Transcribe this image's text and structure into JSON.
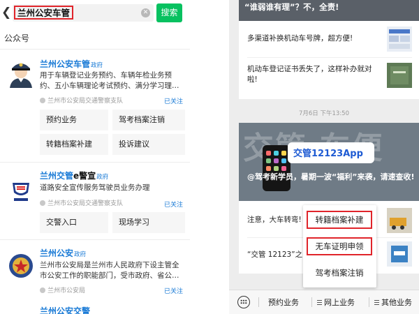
{
  "search": {
    "query": "兰州公安车管",
    "button_label": "搜索"
  },
  "section_title": "公众号",
  "accounts": [
    {
      "name": "兰州公安车管",
      "badge": "政府",
      "description": "用于车辆登记业务预约、车辆年检业务预约、五小车辆理论考试预约、满分学习理…",
      "meta": "兰州市公安局交通警察支队",
      "follow_status": "已关注",
      "menu": [
        "预约业务",
        "驾考档案注销",
        "转籍档案补建",
        "投诉建议"
      ]
    },
    {
      "name_prefix": "兰州交管",
      "name_suffix": "e警宣",
      "badge": "政府",
      "description": "道路安全宣传服务驾驶员业务办理",
      "meta": "兰州市公安局交通警察支队",
      "follow_status": "已关注",
      "menu": [
        "交警入口",
        "现场学习"
      ]
    },
    {
      "name": "兰州公安",
      "badge": "政府",
      "description": "兰州市公安局是兰州市人民政府下设主管全市公安工作的职能部门，受市政府、省公…",
      "meta": "兰州市公安局",
      "follow_status": "已关注",
      "next_name_partial": "兰州公安交警"
    }
  ],
  "chat": {
    "banner_text": "“谁弱谁有理”？不，全责!",
    "articles_top": [
      "多渠道补换机动车号牌，超方便!",
      "机动车登记证书丢失了，这样补办就对啦!"
    ],
    "timestamp": "7月6日 下午13:50",
    "hero_bg_text": "交管 车便",
    "hero_pill": "交管12123App",
    "hero_caption": "@驾考新学员，暑期一波“福利”来袭，请速查收!",
    "articles_bottom": [
      "注意，大车转弯!",
      "“交管 12123”之"
    ]
  },
  "popup_menu": [
    "转籍档案补建",
    "无车证明申领",
    "驾考档案注销"
  ],
  "bottom_menu": [
    "预约业务",
    "网上业务",
    "其他业务"
  ],
  "colors": {
    "highlight_red": "#e0242a",
    "wechat_green": "#07c160",
    "link_blue": "#1b7bd6"
  }
}
